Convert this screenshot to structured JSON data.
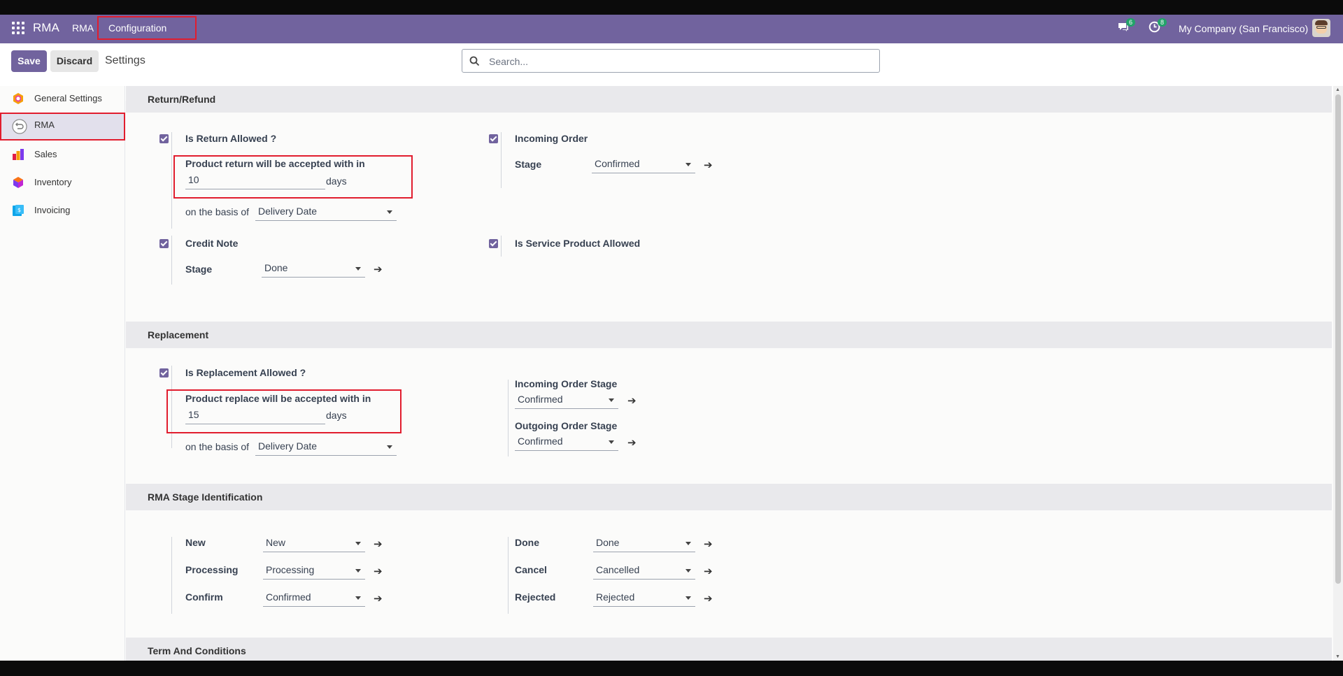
{
  "nav": {
    "brand": "RMA",
    "menu_rma": "RMA",
    "menu_configuration": "Configuration",
    "chat_count": "6",
    "activity_count": "8",
    "company": "My Company (San Francisco)"
  },
  "control": {
    "save": "Save",
    "discard": "Discard",
    "title": "Settings",
    "search_placeholder": "Search..."
  },
  "sidebar": {
    "items": [
      {
        "label": "General Settings",
        "icon": "odoo-logo-icon"
      },
      {
        "label": "RMA",
        "icon": "rma-icon"
      },
      {
        "label": "Sales",
        "icon": "sales-icon"
      },
      {
        "label": "Inventory",
        "icon": "inventory-icon"
      },
      {
        "label": "Invoicing",
        "icon": "invoicing-icon"
      }
    ]
  },
  "return_refund": {
    "header": "Return/Refund",
    "is_return_allowed": "Is Return Allowed ?",
    "accept_label": "Product return will be accepted with in",
    "accept_days": "10",
    "days": "days",
    "basis_label": "on the basis of",
    "basis_value": "Delivery Date",
    "credit_note": "Credit Note",
    "credit_stage_label": "Stage",
    "credit_stage_value": "Done",
    "incoming_order": "Incoming Order",
    "incoming_stage_label": "Stage",
    "incoming_stage_value": "Confirmed",
    "service_product": "Is Service Product Allowed"
  },
  "replacement": {
    "header": "Replacement",
    "is_replacement_allowed": "Is Replacement Allowed ?",
    "accept_label": "Product replace will be accepted with in",
    "accept_days": "15",
    "days": "days",
    "basis_label": "on the basis of",
    "basis_value": "Delivery Date",
    "incoming_stage_label": "Incoming Order Stage",
    "incoming_stage_value": "Confirmed",
    "outgoing_stage_label": "Outgoing Order Stage",
    "outgoing_stage_value": "Confirmed"
  },
  "stage_identification": {
    "header": "RMA Stage Identification",
    "left": [
      {
        "label": "New",
        "value": "New"
      },
      {
        "label": "Processing",
        "value": "Processing"
      },
      {
        "label": "Confirm",
        "value": "Confirmed"
      }
    ],
    "right": [
      {
        "label": "Done",
        "value": "Done"
      },
      {
        "label": "Cancel",
        "value": "Cancelled"
      },
      {
        "label": "Rejected",
        "value": "Rejected"
      }
    ]
  },
  "terms": {
    "header": "Term And Conditions"
  },
  "colors": {
    "nav": "#71639e",
    "accent": "#71639e",
    "highlight": "#e11d2e"
  }
}
